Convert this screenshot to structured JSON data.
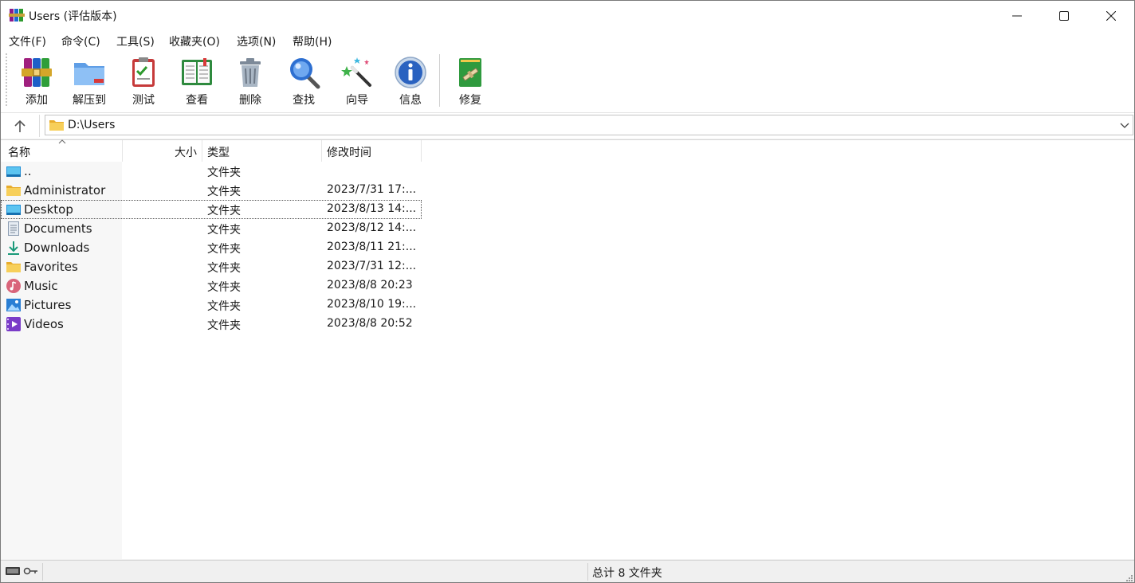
{
  "window": {
    "title": "Users (评估版本)",
    "controls": [
      "minimize-icon",
      "maximize-icon",
      "close-icon"
    ]
  },
  "menu": [
    "文件(F)",
    "命令(C)",
    "工具(S)",
    "收藏夹(O)",
    "选项(N)",
    "帮助(H)"
  ],
  "toolbar": {
    "buttons": [
      {
        "label": "添加",
        "icon": "add-archive-icon"
      },
      {
        "label": "解压到",
        "icon": "extract-folder-icon"
      },
      {
        "label": "测试",
        "icon": "test-clipboard-icon"
      },
      {
        "label": "查看",
        "icon": "view-book-icon"
      },
      {
        "label": "删除",
        "icon": "trash-icon"
      },
      {
        "label": "查找",
        "icon": "find-magnifier-icon"
      },
      {
        "label": "向导",
        "icon": "wizard-wand-icon"
      },
      {
        "label": "信息",
        "icon": "info-icon"
      },
      {
        "label": "修复",
        "icon": "repair-kit-icon"
      }
    ]
  },
  "address": {
    "path": "D:\\Users"
  },
  "columns": {
    "name": "名称",
    "size": "大小",
    "type": "类型",
    "modified": "修改时间"
  },
  "files": [
    {
      "name": "..",
      "type": "文件夹",
      "modified": "",
      "icon": "parent-folder-icon"
    },
    {
      "name": "Administrator",
      "type": "文件夹",
      "modified": "2023/7/31 17:...",
      "icon": "folder-icon"
    },
    {
      "name": "Desktop",
      "type": "文件夹",
      "modified": "2023/8/13 14:...",
      "icon": "desktop-icon",
      "focused": true
    },
    {
      "name": "Documents",
      "type": "文件夹",
      "modified": "2023/8/12 14:...",
      "icon": "documents-icon"
    },
    {
      "name": "Downloads",
      "type": "文件夹",
      "modified": "2023/8/11 21:...",
      "icon": "downloads-icon"
    },
    {
      "name": "Favorites",
      "type": "文件夹",
      "modified": "2023/7/31 12:...",
      "icon": "folder-icon"
    },
    {
      "name": "Music",
      "type": "文件夹",
      "modified": "2023/8/8 20:23",
      "icon": "music-icon"
    },
    {
      "name": "Pictures",
      "type": "文件夹",
      "modified": "2023/8/10 19:...",
      "icon": "pictures-icon"
    },
    {
      "name": "Videos",
      "type": "文件夹",
      "modified": "2023/8/8 20:52",
      "icon": "videos-icon"
    }
  ],
  "status": {
    "summary": "总计 8 文件夹"
  },
  "colors": {
    "folder": "#f4c242",
    "accent": "#0078d4",
    "window_bg": "#f0f0f0"
  }
}
